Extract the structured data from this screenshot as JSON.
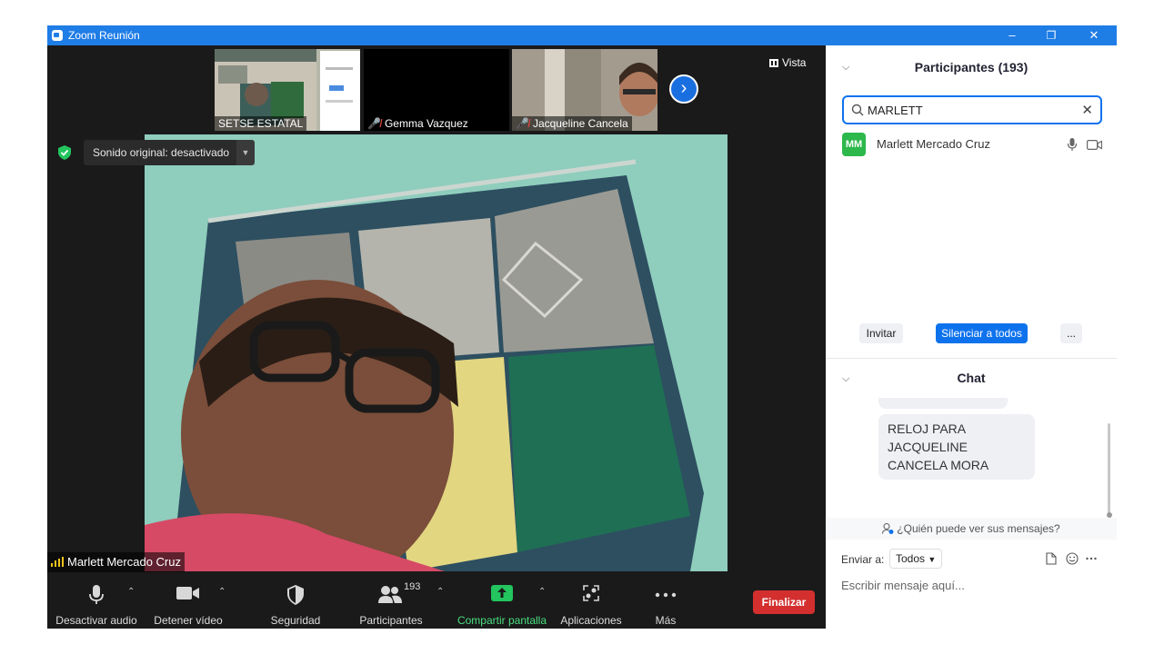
{
  "window": {
    "title": "Zoom Reunión",
    "minimize": "–",
    "restore": "❐",
    "close": "✕"
  },
  "thumbnails": [
    {
      "name": "SETSE ESTATAL",
      "muted": false
    },
    {
      "name": "Gemma Vazquez",
      "muted": true
    },
    {
      "name": "Jacqueline Cancela",
      "muted": true
    }
  ],
  "view_button": "Vista",
  "sound_badge": "Sonido original: desactivado",
  "active_speaker": "Marlett Mercado Cruz",
  "toolbar": {
    "mute_label": "Desactivar audio",
    "video_label": "Detener vídeo",
    "security_label": "Seguridad",
    "participants_label": "Participantes",
    "participants_count": "193",
    "share_label": "Compartir pantalla",
    "apps_label": "Aplicaciones",
    "more_label": "Más",
    "end_label": "Finalizar"
  },
  "participants_panel": {
    "title": "Participantes (193)",
    "search_value": "MARLETT",
    "results": [
      {
        "initials": "MM",
        "name": "Marlett Mercado Cruz"
      }
    ],
    "invite": "Invitar",
    "mute_all": "Silenciar a todos",
    "more": "..."
  },
  "chat_panel": {
    "title": "Chat",
    "messages": [
      "RELOJ PARA JACQUELINE CANCELA MORA"
    ],
    "who_sees": "¿Quién puede ver sus mensajes?",
    "send_to_label": "Enviar a:",
    "send_to_value": "Todos",
    "input_placeholder": "Escribir mensaje aquí..."
  },
  "colors": {
    "title_bar": "#1f7de6",
    "accent": "#0e72ed",
    "end": "#d32f2f",
    "share": "#22c55e"
  }
}
